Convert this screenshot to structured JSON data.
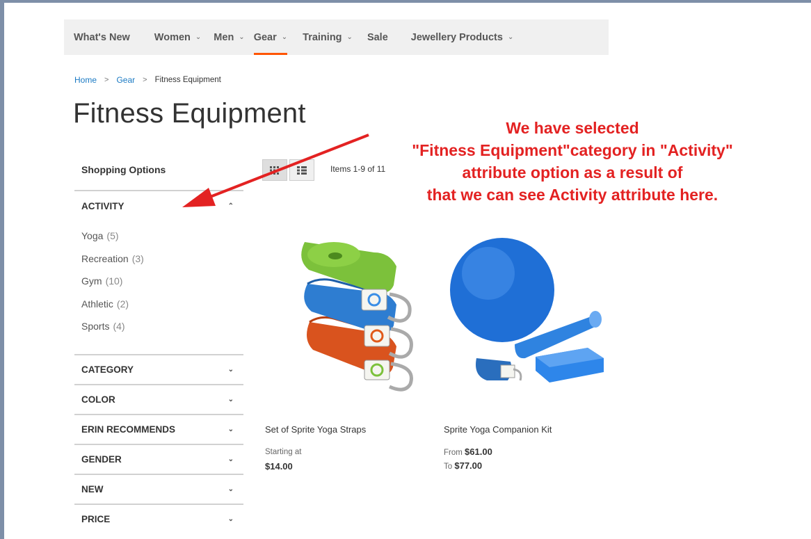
{
  "nav": {
    "items": [
      {
        "label": "What's New"
      },
      {
        "label": "Women"
      },
      {
        "label": "Men"
      },
      {
        "label": "Gear"
      },
      {
        "label": "Training"
      },
      {
        "label": "Sale"
      },
      {
        "label": "Jewellery Products"
      }
    ],
    "active_item": "Gear",
    "accent_color": "#ff5501"
  },
  "breadcrumb": {
    "home": "Home",
    "gear": "Gear",
    "current": "Fitness Equipment",
    "separator": ">"
  },
  "page_title": "Fitness Equipment",
  "sidebar": {
    "shopping_options": "Shopping Options",
    "activity": {
      "title": "ACTIVITY",
      "expanded": true,
      "options": [
        {
          "label": "Yoga",
          "count": "(5)"
        },
        {
          "label": "Recreation",
          "count": "(3)"
        },
        {
          "label": "Gym",
          "count": "(10)"
        },
        {
          "label": "Athletic",
          "count": "(2)"
        },
        {
          "label": "Sports",
          "count": "(4)"
        }
      ]
    },
    "filters": [
      {
        "title": "CATEGORY"
      },
      {
        "title": "COLOR"
      },
      {
        "title": "ERIN RECOMMENDS"
      },
      {
        "title": "GENDER"
      },
      {
        "title": "NEW"
      },
      {
        "title": "PRICE"
      }
    ]
  },
  "toolbar": {
    "items_count": "Items 1-9 of 11",
    "view_modes": [
      "grid",
      "list"
    ],
    "active_view_mode": "grid"
  },
  "products": [
    {
      "name": "Set of Sprite Yoga Straps",
      "price_label": "Starting at",
      "price": "$14.00"
    },
    {
      "name": "Sprite Yoga Companion Kit",
      "from_label": "From",
      "from_price": "$61.00",
      "to_label": "To",
      "to_price": "$77.00"
    }
  ],
  "annotation": {
    "lines": [
      "We have selected",
      "\"Fitness Equipment\"category in \"Activity\"",
      "attribute option as a result of",
      "that we can see Activity attribute here."
    ],
    "color": "#e32222"
  }
}
